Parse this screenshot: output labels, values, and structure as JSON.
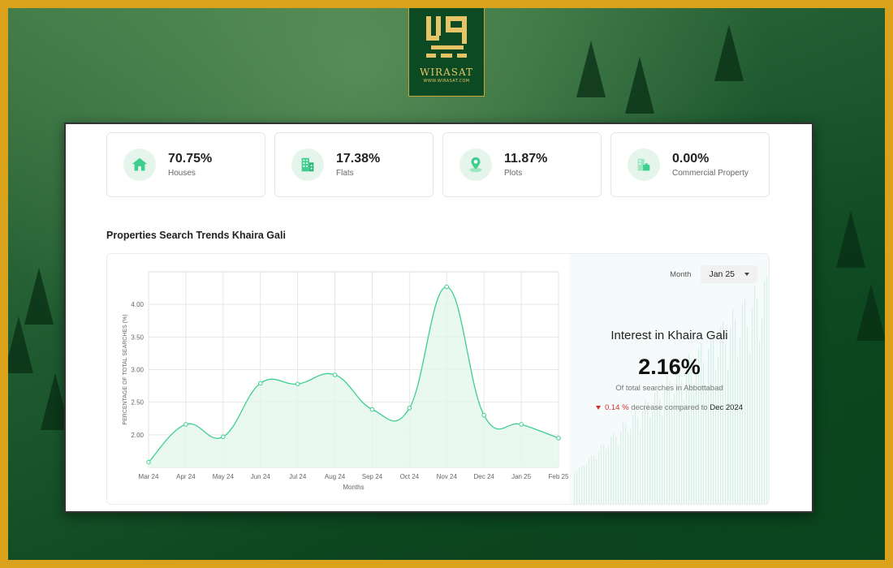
{
  "brand": {
    "name": "WIRASAT",
    "url": "WWW.WIRASAT.COM",
    "colors": {
      "gold": "#d9a21a",
      "green": "#0b4a22"
    }
  },
  "stats": [
    {
      "icon": "house-icon",
      "value": "70.75%",
      "label": "Houses"
    },
    {
      "icon": "building-icon",
      "value": "17.38%",
      "label": "Flats"
    },
    {
      "icon": "map-pin-icon",
      "value": "11.87%",
      "label": "Plots"
    },
    {
      "icon": "office-building-icon",
      "value": "0.00%",
      "label": "Commercial Property"
    }
  ],
  "section_title": "Properties Search Trends Khaira Gali",
  "side": {
    "month_label": "Month",
    "month_value": "Jan 25",
    "interest_title": "Interest in Khaira Gali",
    "interest_value": "2.16%",
    "interest_sub": "Of total searches in Abbottabad",
    "change_value": "0.14 %",
    "change_text": "decrease compared to",
    "compare_month": "Dec 2024",
    "accent_color": "#d0312d"
  },
  "chart_data": {
    "type": "area",
    "x": [
      "Mar 24",
      "Apr 24",
      "May 24",
      "Jun 24",
      "Jul 24",
      "Aug 24",
      "Sep 24",
      "Oct 24",
      "Nov 24",
      "Dec 24",
      "Jan 25",
      "Feb 25"
    ],
    "series": [
      {
        "values": [
          1.58,
          2.16,
          1.97,
          2.79,
          2.78,
          2.92,
          2.39,
          2.41,
          4.27,
          2.3,
          2.16,
          1.95
        ]
      }
    ],
    "yticks": [
      "2.00",
      "2.50",
      "3.00",
      "3.50",
      "4.00"
    ],
    "ylim": [
      1.5,
      4.5
    ],
    "xlabel": "Months",
    "ylabel": "PERCENTAGE OF TOTAL SEARCHES (%)",
    "grid": true,
    "line_color": "#3ecf8e",
    "fill_color": "#e3f7ee"
  }
}
